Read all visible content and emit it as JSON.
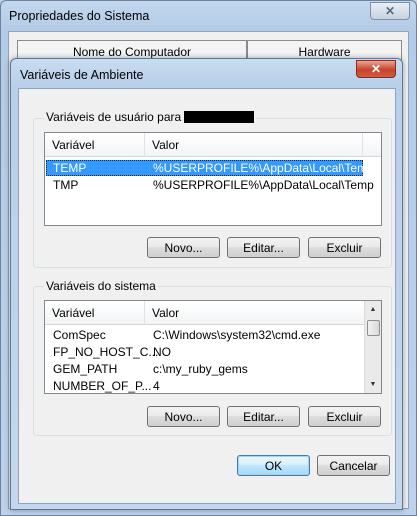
{
  "outer_window": {
    "title": "Propriedades do Sistema",
    "close_glyph": "✕",
    "tabs": [
      {
        "label": "Nome do Computador"
      },
      {
        "label": "Hardware"
      }
    ]
  },
  "dialog": {
    "title": "Variáveis de Ambiente",
    "close_glyph": "✕",
    "user_vars": {
      "legend": "Variáveis de usuário para",
      "columns": [
        "Variável",
        "Valor"
      ],
      "rows": [
        {
          "name": "TEMP",
          "value": "%USERPROFILE%\\AppData\\Local\\Temp",
          "selected": true
        },
        {
          "name": "TMP",
          "value": "%USERPROFILE%\\AppData\\Local\\Temp",
          "selected": false
        }
      ],
      "buttons": {
        "new": "Novo...",
        "edit": "Editar...",
        "delete": "Excluir"
      }
    },
    "system_vars": {
      "legend": "Variáveis do sistema",
      "columns": [
        "Variável",
        "Valor"
      ],
      "rows": [
        {
          "name": "ComSpec",
          "value": "C:\\Windows\\system32\\cmd.exe"
        },
        {
          "name": "FP_NO_HOST_C...",
          "value": "NO"
        },
        {
          "name": "GEM_PATH",
          "value": "c:\\my_ruby_gems"
        },
        {
          "name": "NUMBER_OF_P...",
          "value": "4"
        }
      ],
      "buttons": {
        "new": "Novo...",
        "edit": "Editar...",
        "delete": "Excluir"
      }
    },
    "footer": {
      "ok": "OK",
      "cancel": "Cancelar"
    },
    "icons": {
      "scroll_up": "▲",
      "scroll_down": "▼"
    }
  }
}
